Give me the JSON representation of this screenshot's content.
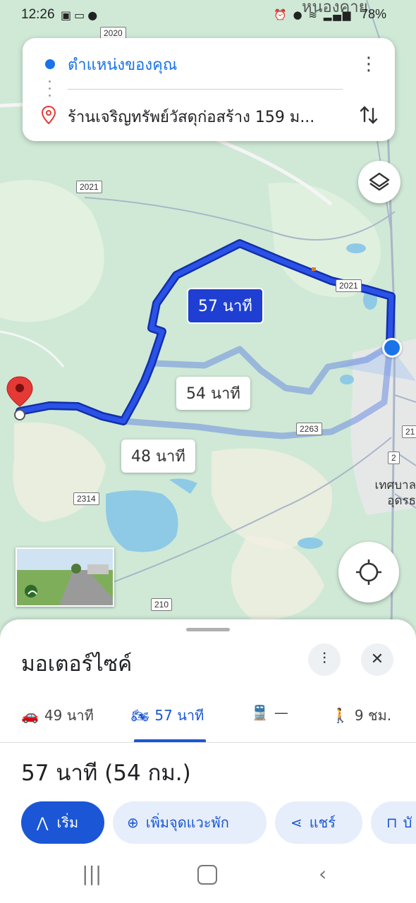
{
  "status_bar": {
    "time": "12:26",
    "notification_icons": [
      "gallery-icon",
      "voicemail-icon",
      "line-icon"
    ],
    "right_icons": [
      "alarm-icon",
      "location-icon",
      "wifi-icon",
      "volte-icon",
      "signal-icon"
    ],
    "battery": "78%"
  },
  "search": {
    "from": "ตำแหน่งของคุณ",
    "to": "ร้านเจริญทรัพย์วัสดุก่อสร้าง 159 ม..."
  },
  "map": {
    "top_place_label": "หนองคาย",
    "routes": [
      {
        "label": "57 นาที",
        "selected": true
      },
      {
        "label": "54 นาที",
        "selected": false
      },
      {
        "label": "48 นาที",
        "selected": false
      }
    ],
    "road_badges": [
      "2020",
      "2021",
      "2021",
      "2263",
      "2314",
      "210",
      "21",
      "2"
    ],
    "place_labels": [
      "เทศบาล",
      "อุดรธ"
    ]
  },
  "sheet": {
    "title": "มอเตอร์ไซค์",
    "modes": [
      {
        "icon": "car-icon",
        "label": "49 นาที"
      },
      {
        "icon": "motorcycle-icon",
        "label": "57 นาที"
      },
      {
        "icon": "transit-icon",
        "label": "—"
      },
      {
        "icon": "walk-icon",
        "label": "9 ชม."
      }
    ],
    "summary": "57 นาที (54 กม.)",
    "actions": {
      "start": "เริ่ม",
      "add_stop": "เพิ่มจุดแวะพัก",
      "share": "แชร์",
      "save": "บั"
    }
  },
  "colors": {
    "primary": "#1a56d6",
    "route_selected": "#1e3fd1",
    "route_alt": "#8fa6e8",
    "map_green": "#cfe9d6",
    "water": "#8ecae6"
  }
}
